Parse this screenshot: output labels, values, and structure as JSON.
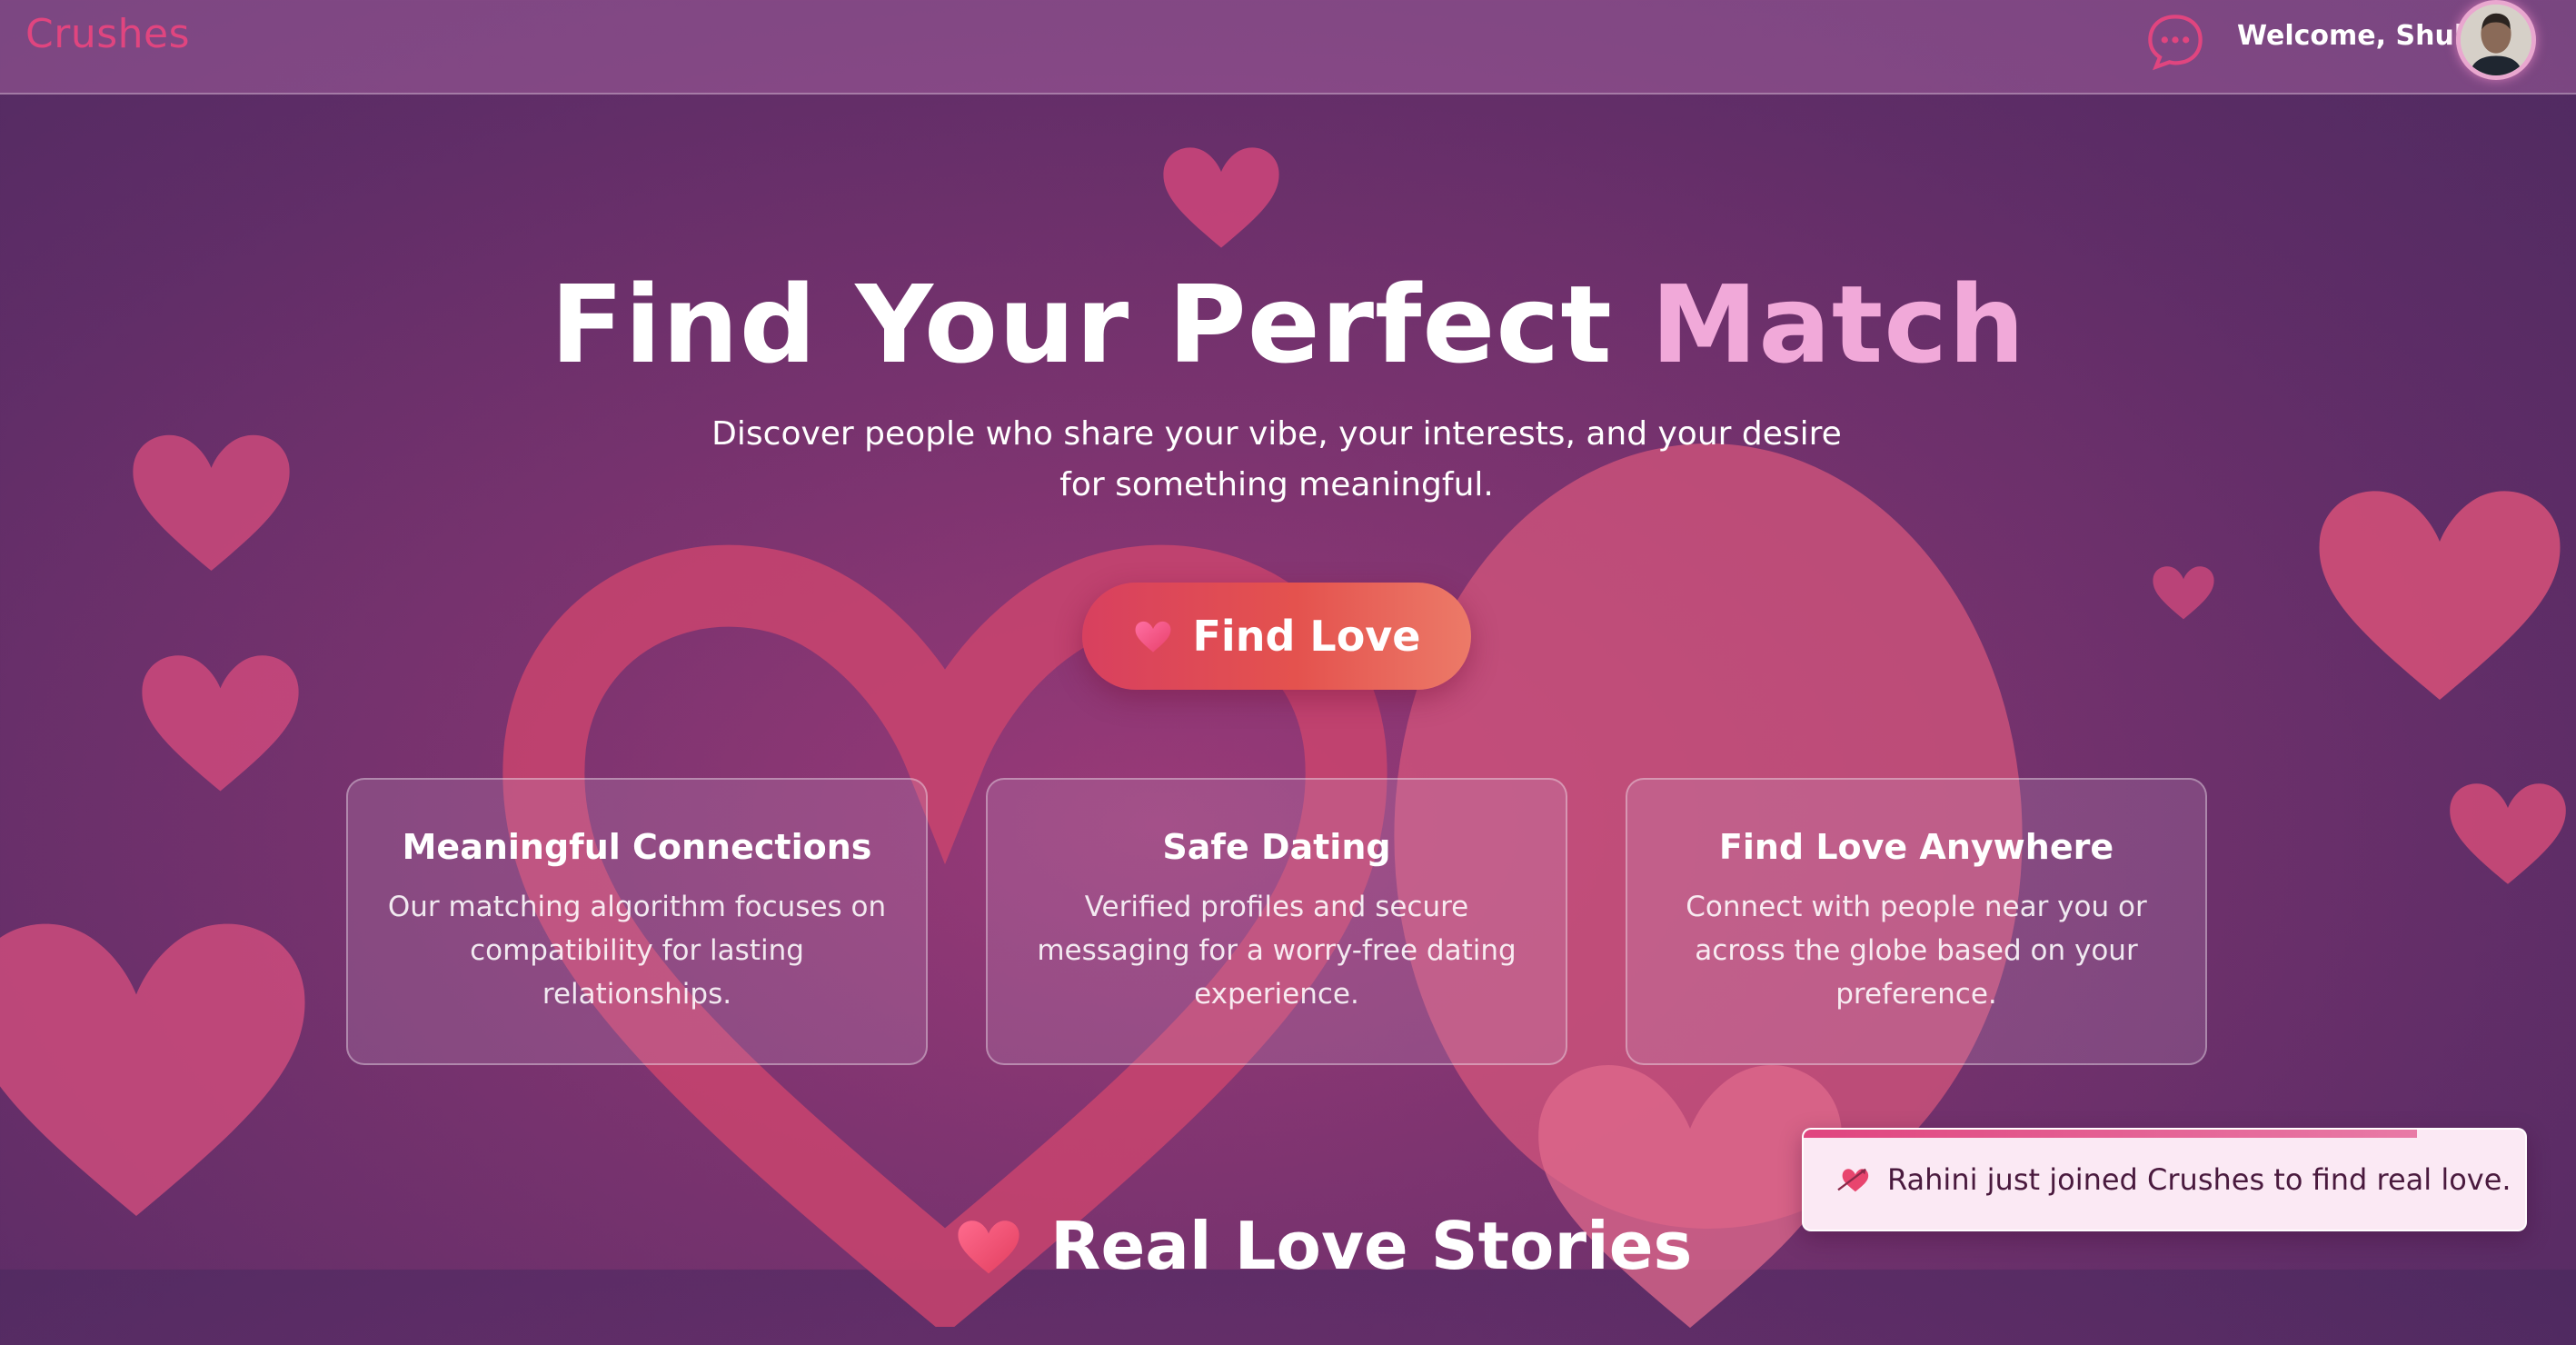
{
  "navbar": {
    "brand": "Crushes",
    "chat_icon": "chat-bubble-dots-icon",
    "welcome": "Welcome, Shub",
    "avatar": "user-avatar"
  },
  "hero": {
    "title_main": "Find Your Perfect ",
    "title_accent": "Match",
    "subtitle": "Discover people who share your vibe, your interests, and your desire for something meaningful.",
    "cta_label": "Find Love",
    "cta_icon": "heart-icon"
  },
  "features": [
    {
      "title": "Meaningful Connections",
      "text": "Our matching algorithm focuses on compatibility for lasting relationships."
    },
    {
      "title": "Safe Dating",
      "text": "Verified profiles and secure messaging for a worry-free dating experience."
    },
    {
      "title": "Find Love Anywhere",
      "text": "Connect with people near you or across the globe based on your preference."
    }
  ],
  "stories": {
    "title": "Real Love Stories",
    "icon": "heart-icon"
  },
  "toast": {
    "text": "Rahini just joined Crushes to find real love.",
    "icon": "heart-arrow-icon",
    "progress": 0.85
  },
  "colors": {
    "brand": "#e0457f",
    "accent": "#f1a9d9",
    "cta_start": "#d8405f",
    "cta_end": "#ec7a68",
    "background": "#6a2f68"
  }
}
